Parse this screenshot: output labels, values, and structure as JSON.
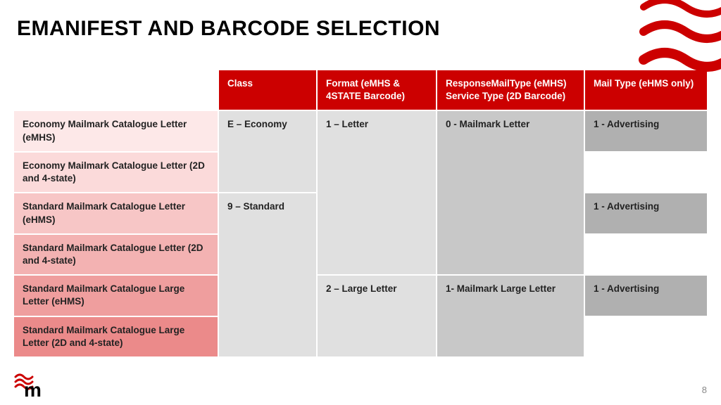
{
  "title": "EMANIFEST AND BARCODE SELECTION",
  "pageNumber": "8",
  "headers": {
    "class": "Class",
    "format": "Format (eMHS & 4STATE Barcode)",
    "response": "ResponseMailType (eMHS) Service Type (2D Barcode)",
    "mailtype": "Mail Type (eHMS only)"
  },
  "rows": {
    "r1": "Economy Mailmark Catalogue Letter (eMHS)",
    "r2": "Economy Mailmark Catalogue Letter (2D and 4-state)",
    "r3": "Standard Mailmark Catalogue Letter (eHMS)",
    "r4": "Standard Mailmark Catalogue Letter (2D and 4-state)",
    "r5": "Standard Mailmark Catalogue Large Letter (eHMS)",
    "r6": "Standard Mailmark Catalogue Large Letter (2D and  4-state)"
  },
  "cells": {
    "classEconomy": "E – Economy",
    "classStandard": "9 – Standard",
    "formatLetter": "1 – Letter",
    "formatLarge": "2 – Large Letter",
    "respLetter": "0 - Mailmark Letter",
    "respLarge": "1- Mailmark Large Letter",
    "mailAdv": "1 - Advertising"
  }
}
